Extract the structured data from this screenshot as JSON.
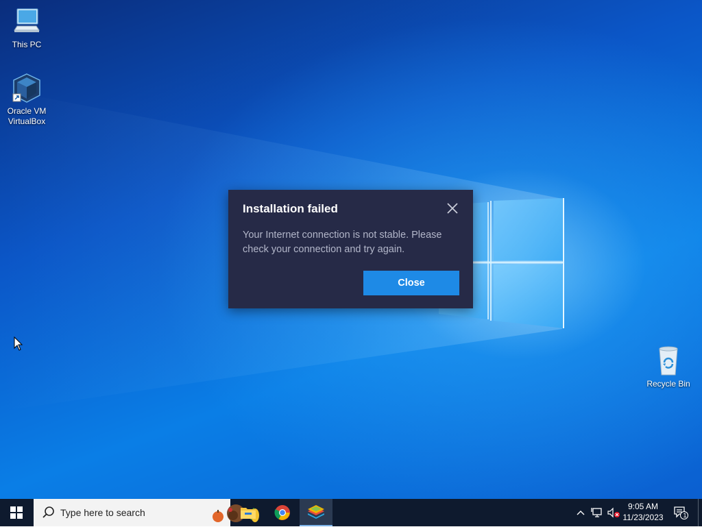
{
  "desktop": {
    "icons": [
      {
        "label": "This PC",
        "icon": "computer-icon"
      },
      {
        "label": "Oracle VM VirtualBox",
        "icon": "virtualbox-icon"
      },
      {
        "label": "Recycle Bin",
        "icon": "recycle-bin-icon"
      }
    ]
  },
  "dialog": {
    "title": "Installation failed",
    "message": "Your Internet connection is not stable. Please check your connection and try again.",
    "close_button_label": "Close",
    "accent_color": "#1e8ae6",
    "background_color": "#262a47"
  },
  "taskbar": {
    "search_placeholder": "Type here to search",
    "pinned_apps": [
      {
        "name": "File Explorer",
        "icon": "file-explorer-icon"
      },
      {
        "name": "Google Chrome",
        "icon": "chrome-icon"
      },
      {
        "name": "BlueStacks",
        "icon": "bluestacks-icon",
        "active": true
      }
    ],
    "tray": {
      "time": "9:05 AM",
      "date": "11/23/2023",
      "notification_count": "1"
    }
  }
}
